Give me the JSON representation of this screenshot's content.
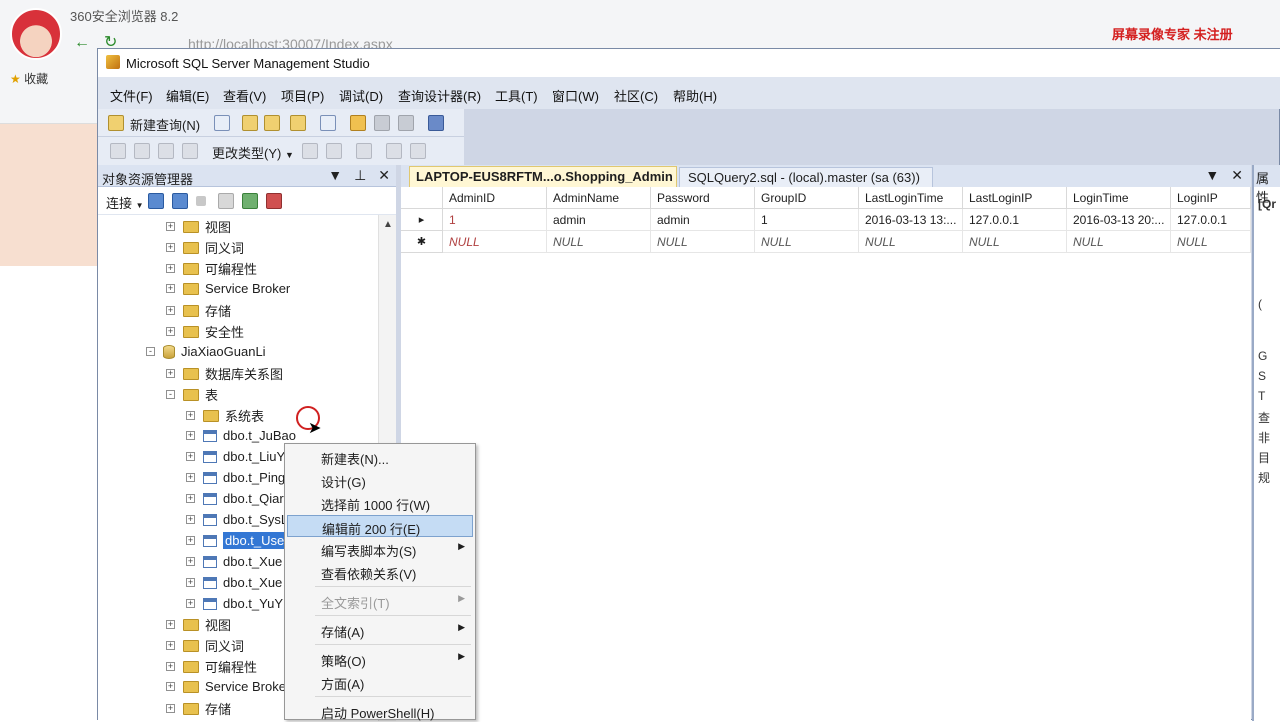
{
  "browser": {
    "title": "360安全浏览器 8.2",
    "url": "http://localhost:30007/Index.aspx",
    "favorites": "收藏",
    "watermark": "屏幕录像专家 未注册"
  },
  "ssms": {
    "title": "Microsoft SQL Server Management Studio",
    "menu": [
      "文件(F)",
      "编辑(E)",
      "查看(V)",
      "项目(P)",
      "调试(D)",
      "查询设计器(R)",
      "工具(T)",
      "窗口(W)",
      "社区(C)",
      "帮助(H)"
    ],
    "toolbar": {
      "new_query": "新建查询(N)",
      "change_type": "更改类型(Y)"
    }
  },
  "object_explorer": {
    "title": "对象资源管理器",
    "connect": "连接",
    "tree": [
      {
        "label": "视图",
        "icon": "folder-icon",
        "exp": "+"
      },
      {
        "label": "同义词",
        "icon": "folder-icon",
        "exp": "+"
      },
      {
        "label": "可编程性",
        "icon": "folder-icon",
        "exp": "+"
      },
      {
        "label": "Service Broker",
        "icon": "folder-icon",
        "exp": "+"
      },
      {
        "label": "存储",
        "icon": "folder-icon",
        "exp": "+"
      },
      {
        "label": "安全性",
        "icon": "folder-icon",
        "exp": "+"
      },
      {
        "label": "JiaXiaoGuanLi",
        "icon": "database-icon",
        "exp": "-"
      },
      {
        "label": "数据库关系图",
        "icon": "folder-icon",
        "exp": "+"
      },
      {
        "label": "表",
        "icon": "folder-icon",
        "exp": "-"
      },
      {
        "label": "系统表",
        "icon": "folder-icon",
        "exp": "+"
      },
      {
        "label": "dbo.t_JuBao",
        "icon": "table-icon",
        "exp": "+"
      },
      {
        "label": "dbo.t_LiuY",
        "icon": "table-icon",
        "exp": "+"
      },
      {
        "label": "dbo.t_Ping",
        "icon": "table-icon",
        "exp": "+"
      },
      {
        "label": "dbo.t_Qiar",
        "icon": "table-icon",
        "exp": "+"
      },
      {
        "label": "dbo.t_SysL",
        "icon": "table-icon",
        "exp": "+"
      },
      {
        "label": "dbo.t_Use",
        "icon": "table-icon",
        "exp": "+"
      },
      {
        "label": "dbo.t_Xue",
        "icon": "table-icon",
        "exp": "+"
      },
      {
        "label": "dbo.t_Xue",
        "icon": "table-icon",
        "exp": "+"
      },
      {
        "label": "dbo.t_YuY",
        "icon": "table-icon",
        "exp": "+"
      },
      {
        "label": "视图",
        "icon": "folder-icon",
        "exp": "+"
      },
      {
        "label": "同义词",
        "icon": "folder-icon",
        "exp": "+"
      },
      {
        "label": "可编程性",
        "icon": "folder-icon",
        "exp": "+"
      },
      {
        "label": "Service Broke",
        "icon": "folder-icon",
        "exp": "+"
      },
      {
        "label": "存储",
        "icon": "folder-icon",
        "exp": "+"
      }
    ]
  },
  "tabs": {
    "active": "LAPTOP-EUS8RFTM...o.Shopping_Admin",
    "second": "SQLQuery2.sql - (local).master (sa (63))"
  },
  "grid": {
    "columns": [
      "AdminID",
      "AdminName",
      "Password",
      "GroupID",
      "LastLoginTime",
      "LastLoginIP",
      "LoginTime",
      "LoginIP"
    ],
    "rows": [
      [
        "1",
        "admin",
        "admin",
        "1",
        "2016-03-13 13:...",
        "127.0.0.1",
        "2016-03-13 20:...",
        "127.0.0.1"
      ],
      [
        "NULL",
        "NULL",
        "NULL",
        "NULL",
        "NULL",
        "NULL",
        "NULL",
        "NULL"
      ]
    ],
    "row_markers": [
      "▸",
      "✱"
    ]
  },
  "properties": {
    "title": "属性",
    "fragments": [
      "[Qr",
      "(",
      "G",
      "S",
      "T",
      "查",
      "非",
      "目",
      "规"
    ]
  },
  "context_menu": {
    "items": [
      {
        "label": "新建表(N)...",
        "submenu": false,
        "disabled": false
      },
      {
        "label": "设计(G)",
        "submenu": false,
        "disabled": false
      },
      {
        "label": "选择前 1000 行(W)",
        "submenu": false,
        "disabled": false
      },
      {
        "label": "编辑前 200 行(E)",
        "submenu": false,
        "disabled": false,
        "highlighted": true
      },
      {
        "label": "编写表脚本为(S)",
        "submenu": true,
        "disabled": false
      },
      {
        "label": "查看依赖关系(V)",
        "submenu": false,
        "disabled": false
      },
      {
        "label": "全文索引(T)",
        "submenu": true,
        "disabled": true
      },
      {
        "label": "存储(A)",
        "submenu": true,
        "disabled": false
      },
      {
        "label": "策略(O)",
        "submenu": true,
        "disabled": false
      },
      {
        "label": "方面(A)",
        "submenu": false,
        "disabled": false
      },
      {
        "label": "启动 PowerShell(H)",
        "submenu": false,
        "disabled": false
      }
    ]
  }
}
